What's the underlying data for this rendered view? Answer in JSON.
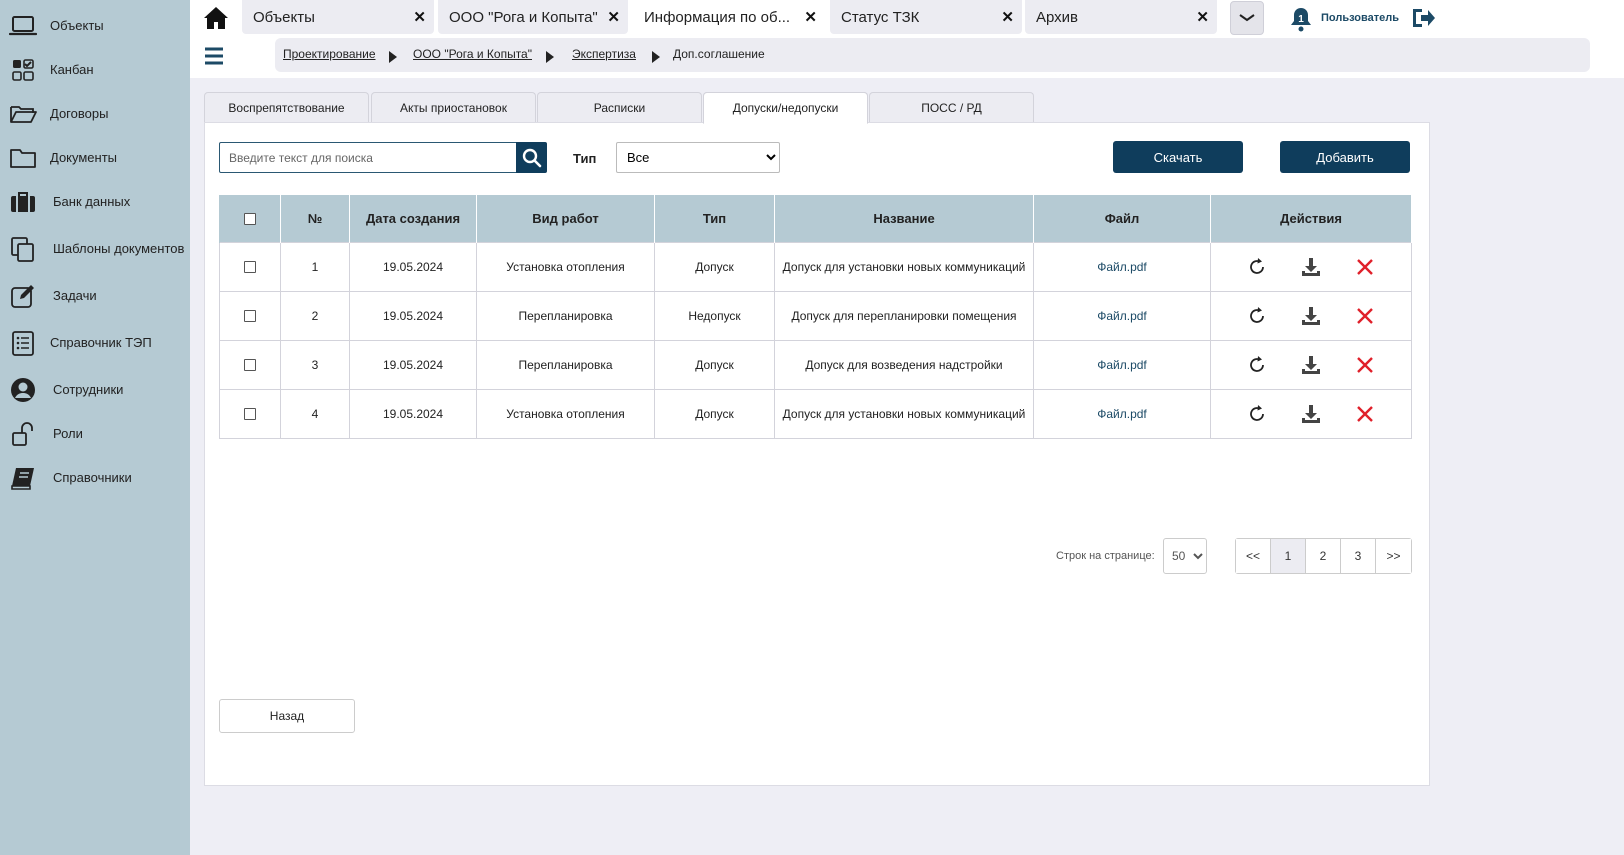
{
  "sidebar": {
    "items": [
      {
        "label": "Объекты",
        "icon": "laptop-icon"
      },
      {
        "label": "Канбан",
        "icon": "kanban-icon"
      },
      {
        "label": "Договоры",
        "icon": "folder-open-icon"
      },
      {
        "label": "Документы",
        "icon": "folder-icon"
      },
      {
        "label": "Банк данных",
        "icon": "briefcase-icon"
      },
      {
        "label": "Шаблоны документов",
        "icon": "copy-icon"
      },
      {
        "label": "Задачи",
        "icon": "edit-icon"
      },
      {
        "label": "Справочник ТЭП",
        "icon": "list-icon"
      },
      {
        "label": "Сотрудники",
        "icon": "user-circle-icon"
      },
      {
        "label": "Роли",
        "icon": "unlock-icon"
      },
      {
        "label": "Справочники",
        "icon": "book-icon"
      }
    ]
  },
  "topbar": {
    "tabs": [
      {
        "label": "Объекты"
      },
      {
        "label": "ООО \"Рога и Копыта\""
      },
      {
        "label": "Информация по об..."
      },
      {
        "label": "Статус ТЗК"
      },
      {
        "label": "Архив"
      }
    ],
    "close_glyph": "✕",
    "notifications_count": "1",
    "user_label": "Пользователь"
  },
  "breadcrumb": {
    "items": [
      "Проектирование",
      "ООО \"Рога и Копыта\"",
      "Экспертиза",
      "Доп.соглашение"
    ]
  },
  "content_tabs": [
    "Воспрепятствование",
    "Акты приостановок",
    "Расписки",
    "Допуски/недопуски",
    "ПОСС / РД"
  ],
  "toolbar": {
    "search_placeholder": "Введите текст для поиска",
    "type_label": "Тип",
    "type_value": "Все",
    "download_label": "Скачать",
    "add_label": "Добавить"
  },
  "table": {
    "headers": [
      "№",
      "Дата создания",
      "Вид работ",
      "Тип",
      "Название",
      "Файл",
      "Действия"
    ],
    "rows": [
      {
        "num": "1",
        "date": "19.05.2024",
        "work": "Установка отопления",
        "type": "Допуск",
        "name": "Допуск для установки новых коммуникаций",
        "file": "Файл.pdf"
      },
      {
        "num": "2",
        "date": "19.05.2024",
        "work": "Перепланировка",
        "type": "Недопуск",
        "name": "Допуск для перепланировки помещения",
        "file": "Файл.pdf"
      },
      {
        "num": "3",
        "date": "19.05.2024",
        "work": "Перепланировка",
        "type": "Допуск",
        "name": "Допуск для возведения надстройки",
        "file": "Файл.pdf"
      },
      {
        "num": "4",
        "date": "19.05.2024",
        "work": "Установка отопления",
        "type": "Допуск",
        "name": "Допуск для установки новых коммуникаций",
        "file": "Файл.pdf"
      }
    ]
  },
  "pagination": {
    "rows_label": "Строк на странице:",
    "rows_value": "50",
    "first": "<<",
    "pages": [
      "1",
      "2",
      "3"
    ],
    "last": ">>",
    "current": "1"
  },
  "back_label": "Назад",
  "colors": {
    "sidebar_bg": "#b5cad3",
    "accent": "#0f3d5c",
    "delete_red": "#e0202a"
  }
}
